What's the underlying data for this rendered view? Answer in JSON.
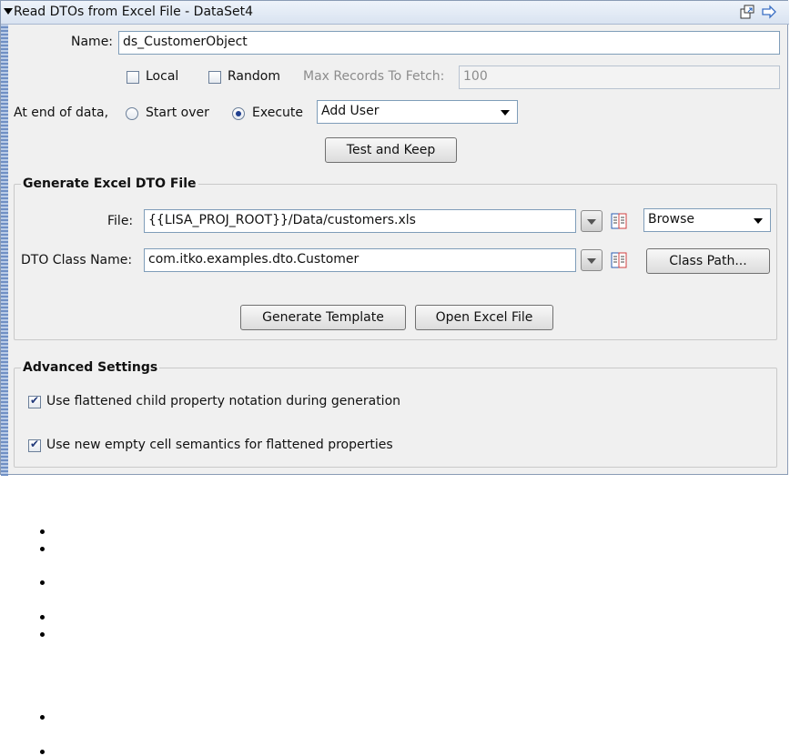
{
  "window": {
    "title": "Read DTOs from Excel File - DataSet4"
  },
  "form": {
    "name_label": "Name:",
    "name_value": "ds_CustomerObject",
    "local_label": "Local",
    "random_label": "Random",
    "max_records_label": "Max Records To Fetch:",
    "max_records_value": "100",
    "end_of_data_label": "At end of data,",
    "start_over_label": "Start over",
    "execute_label": "Execute",
    "execute_target": "Add User",
    "test_keep_label": "Test and Keep"
  },
  "generate": {
    "title": "Generate Excel DTO File",
    "file_label": "File:",
    "file_value": "{{LISA_PROJ_ROOT}}/Data/customers.xls",
    "browse_label": "Browse",
    "dto_label": "DTO Class Name:",
    "dto_value": "com.itko.examples.dto.Customer",
    "class_path_label": "Class Path...",
    "generate_template_label": "Generate Template",
    "open_excel_label": "Open Excel File"
  },
  "advanced": {
    "title": "Advanced Settings",
    "option1": "Use flattened child property notation during generation",
    "option2": "Use new empty cell semantics for flattened properties"
  },
  "state": {
    "local_checked": false,
    "random_checked": false,
    "end_of_data_choice": "Execute",
    "option1_checked": true,
    "option2_checked": true
  },
  "bullets_count": 7
}
